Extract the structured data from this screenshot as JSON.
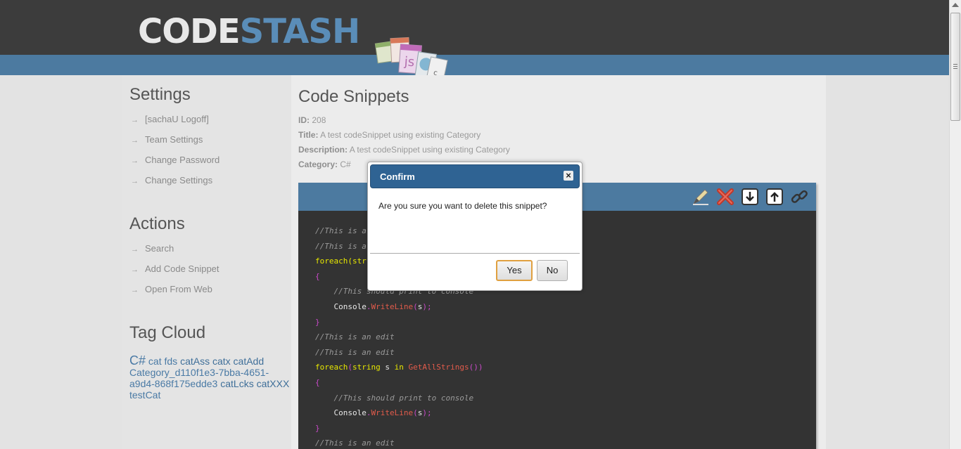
{
  "logo": {
    "part1": "CODE",
    "part2": "STASH"
  },
  "sidebar": {
    "settings_heading": "Settings",
    "settings_items": [
      {
        "label": "[sachaU Logoff]"
      },
      {
        "label": "Team Settings"
      },
      {
        "label": "Change Password"
      },
      {
        "label": "Change Settings"
      }
    ],
    "actions_heading": "Actions",
    "actions_items": [
      {
        "label": "Search"
      },
      {
        "label": "Add Code Snippet"
      },
      {
        "label": "Open From Web"
      }
    ],
    "tagcloud_heading": "Tag Cloud",
    "tags": [
      {
        "label": "C#"
      },
      {
        "label": "cat"
      },
      {
        "label": "fds"
      },
      {
        "label": "catAss"
      },
      {
        "label": "catx"
      },
      {
        "label": "catAdd"
      },
      {
        "label": "Category_d110f1e3-7bba-4651-a9d4-868f175edde3"
      },
      {
        "label": "catLcks"
      },
      {
        "label": "catXXX"
      },
      {
        "label": "testCat"
      }
    ]
  },
  "main": {
    "title": "Code Snippets",
    "id_label": "ID:",
    "id_value": "208",
    "title_label": "Title:",
    "title_value": "A test codeSnippet using existing Category",
    "description_label": "Description:",
    "description_value": "A test codeSnippet using existing Category",
    "category_label": "Category:",
    "category_value": "C#"
  },
  "code": {
    "comment_partial": "//This is a",
    "foreach_partial": "foreach(str",
    "brace_open": "{",
    "brace_close": "}",
    "print_comment": "//This should print to console",
    "console": "Console",
    "dot": ".",
    "writeline": "WriteLine",
    "paren_open": "(",
    "var_s": "s",
    "paren_close_semi": ");",
    "edit_comment": "//This is an edit",
    "foreach_kw": "foreach",
    "string_kw": "string",
    "in_kw": "in",
    "get_all": "GetAllStrings",
    "empty_parens": "())"
  },
  "modal": {
    "title": "Confirm",
    "close_glyph": "×",
    "message": "Are you sure you want to delete this snippet?",
    "yes_label": "Yes",
    "no_label": "No"
  },
  "colors": {
    "header_dark": "#3c3c3c",
    "header_band": "#4c7aa0",
    "modal_header": "#2f6393",
    "accent_link": "#4a7aa5"
  }
}
